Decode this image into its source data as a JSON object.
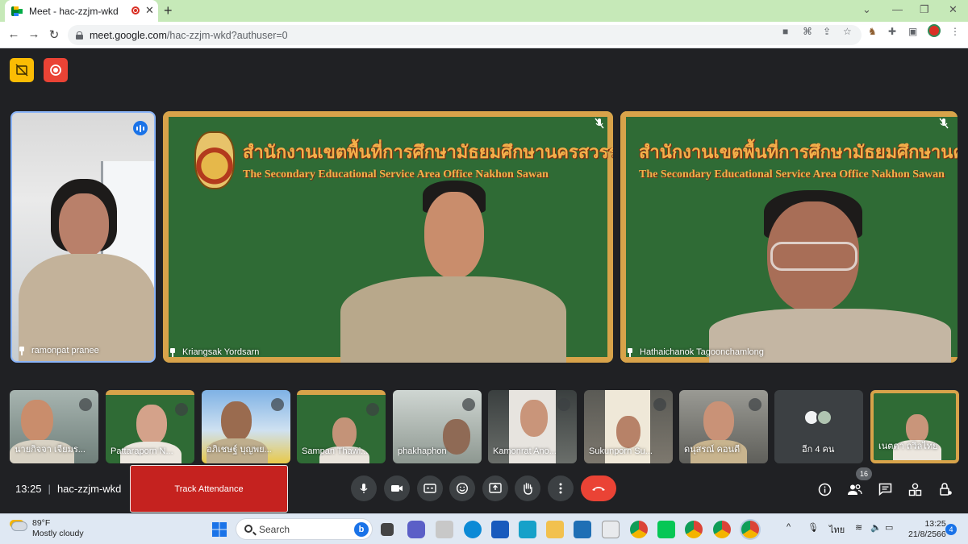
{
  "browser": {
    "tab_title": "Meet - hac-zzjm-wkd",
    "url_host": "meet.google.com",
    "url_path": "/hac-zzjm-wkd?authuser=0"
  },
  "main_tiles": [
    {
      "name": "ramonpat pranee"
    },
    {
      "name": "Kriangsak Yordsarn"
    },
    {
      "name": "Hathaichanok Tagoonchamlong"
    }
  ],
  "background": {
    "banner_th": "สำนักงานเขตพื้นที่การศึกษามัธยมศึกษานครสวรรค์",
    "banner_en": "The Secondary Educational Service Area Office Nakhon Sawan"
  },
  "thumbnails": [
    {
      "name": "นายกิจจา เจียมร..."
    },
    {
      "name": "Pattaraporn N..."
    },
    {
      "name": "อภิเชษฐ์ บุญพย..."
    },
    {
      "name": "Sampan Thawi..."
    },
    {
      "name": "phakhaphon"
    },
    {
      "name": "Kamonrat Ano..."
    },
    {
      "name": "Sukunporn Su..."
    },
    {
      "name": "ดนุสรณ์ คอนดี"
    },
    {
      "name": "อีก 4 คน"
    },
    {
      "name": "เนตดา ถวิลไทย"
    }
  ],
  "controls": {
    "time": "13:25",
    "meeting_code": "hac-zzjm-wkd",
    "track_attendance": "Track Attendance",
    "participants_count": "16"
  },
  "taskbar": {
    "temperature": "89°F",
    "weather": "Mostly cloudy",
    "search_placeholder": "Search",
    "language": "ไทย",
    "clock_time": "13:25",
    "clock_date": "21/8/2566",
    "notifications": "4"
  },
  "colors": {
    "stage_bg": "#202124",
    "tab_strip": "#c6e9b8",
    "accent_blue": "#1a73e8",
    "end_call": "#ea4335",
    "track_button": "#c5221f",
    "board_green": "#2f6b35",
    "board_frame": "#d8a34a",
    "banner_text": "#f3b04a"
  }
}
